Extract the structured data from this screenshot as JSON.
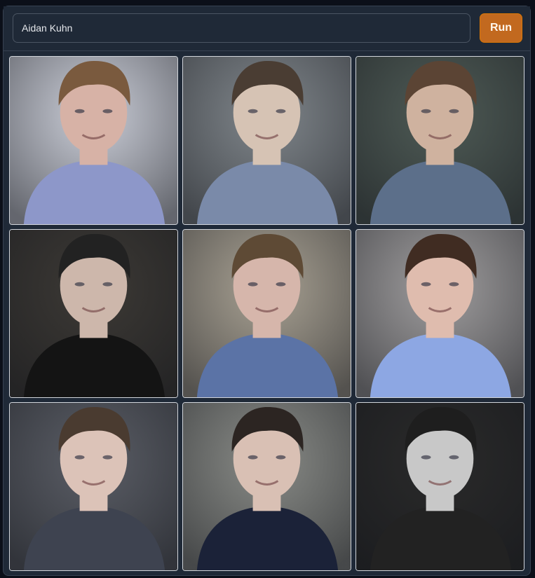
{
  "prompt": {
    "value": "Aidan Kuhn",
    "placeholder": ""
  },
  "run_button": {
    "label": "Run",
    "color": "#c2691f"
  },
  "gallery": {
    "count": 9,
    "images": [
      {
        "bg": "#c9ccd6",
        "shirt": "#8d97c9",
        "hair": "#7a5a3e",
        "skin": "#d7b2a6"
      },
      {
        "bg": "#7f858a",
        "shirt": "#7a8aa9",
        "hair": "#4a3d33",
        "skin": "#d6c3b4"
      },
      {
        "bg": "#4e5a55",
        "shirt": "#5c6f8a",
        "hair": "#5b4434",
        "skin": "#cfb29f"
      },
      {
        "bg": "#3c3935",
        "shirt": "#141414",
        "hair": "#222222",
        "skin": "#cdb7ab"
      },
      {
        "bg": "#a7a092",
        "shirt": "#5b73a6",
        "hair": "#5e4a35",
        "skin": "#d6b6ab"
      },
      {
        "bg": "#9e9c9d",
        "shirt": "#8da7e3",
        "hair": "#402c22",
        "skin": "#dfbcae"
      },
      {
        "bg": "#5a5d65",
        "shirt": "#3e4350",
        "hair": "#4a3b30",
        "skin": "#dcc3b8"
      },
      {
        "bg": "#888a86",
        "shirt": "#1b2238",
        "hair": "#2c2522",
        "skin": "#d9c0b4"
      },
      {
        "bg": "#2a2a2a",
        "shirt": "#222222",
        "hair": "#1e1e1e",
        "skin": "#c8c8c8"
      }
    ]
  }
}
